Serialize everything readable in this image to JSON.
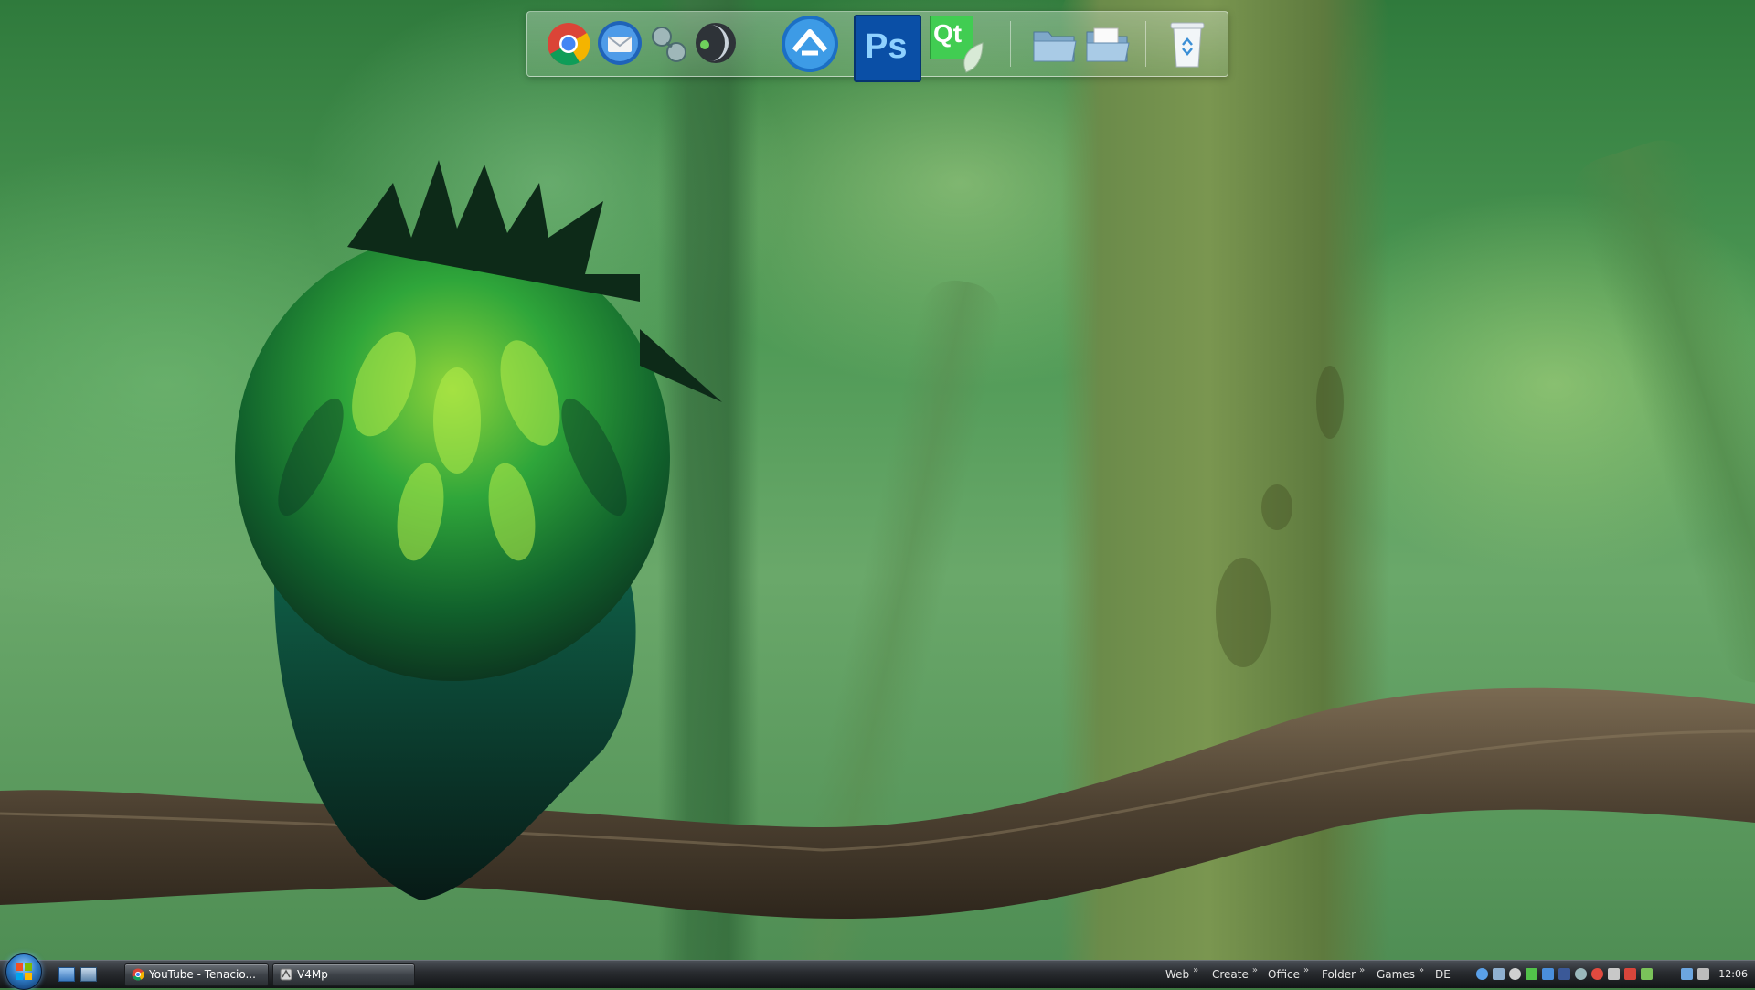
{
  "dock": {
    "items": [
      {
        "name": "chrome-icon"
      },
      {
        "name": "thunderbird-icon"
      },
      {
        "name": "pidgin-icon"
      },
      {
        "name": "winamp-icon"
      },
      {
        "name": "aptana-icon"
      },
      {
        "name": "photoshop-icon",
        "label": "Ps"
      },
      {
        "name": "qt-creator-icon",
        "label": "Qt"
      },
      {
        "name": "folder-icon"
      },
      {
        "name": "open-folder-icon"
      },
      {
        "name": "recycle-bin-icon"
      }
    ]
  },
  "taskbar": {
    "tasks": [
      {
        "label": "YouTube - Tenacio...",
        "icon": "chrome-icon"
      },
      {
        "label": "V4Mp",
        "icon": "app-icon"
      }
    ],
    "toolbar_links": [
      "Web",
      "Create",
      "Office",
      "Folder",
      "Games"
    ],
    "chevron": "»",
    "language": "DE",
    "clock": "12:06"
  },
  "colors": {
    "taskbar": "#1b1d20",
    "accent_blue": "#2e7cc8",
    "photoshop_bg": "#0a4fa6",
    "qt_green": "#41cd52"
  }
}
